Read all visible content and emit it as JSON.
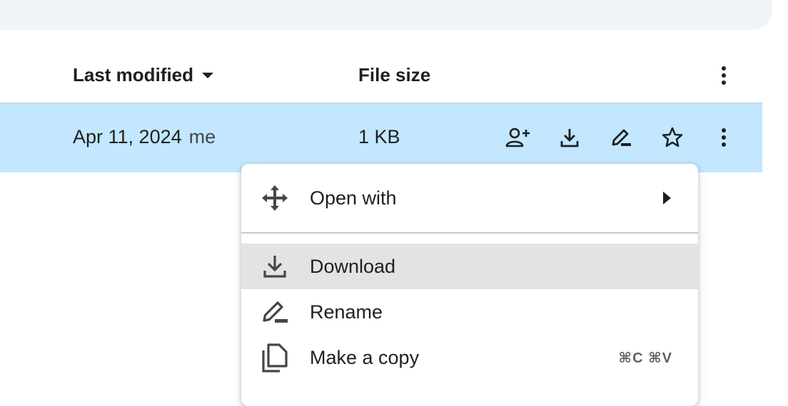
{
  "header": {
    "last_modified": "Last modified",
    "file_size": "File size"
  },
  "row": {
    "date": "Apr 11, 2024",
    "owner": "me",
    "size": "1 KB",
    "actions": [
      "share-icon",
      "download-icon",
      "rename-icon",
      "star-icon",
      "more-icon"
    ]
  },
  "menu": {
    "items": [
      {
        "label": "Open with",
        "icon": "open-with-icon",
        "has_submenu": true
      },
      {
        "label": "Download",
        "icon": "download-icon",
        "highlighted": true
      },
      {
        "label": "Rename",
        "icon": "rename-icon"
      },
      {
        "label": "Make a copy",
        "icon": "copy-icon",
        "shortcut": "⌘C ⌘V"
      }
    ]
  },
  "colors": {
    "selected_row": "#c2e7ff",
    "menu_hover": "#e3e3e3",
    "topbar": "#f0f4f9"
  }
}
